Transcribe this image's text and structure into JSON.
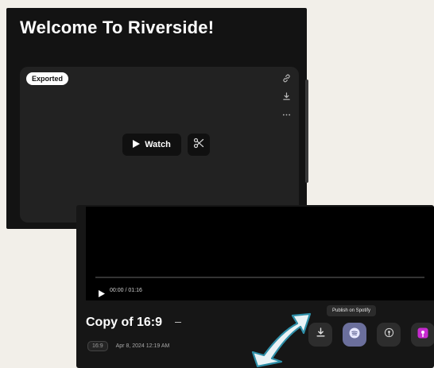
{
  "top_panel": {
    "title": "Welcome To Riverside!",
    "badge": "Exported",
    "watch_label": "Watch"
  },
  "bottom_panel": {
    "time": "00:00 / 01:16",
    "title": "Copy of 16:9",
    "aspect": "16:9",
    "date": "Apr 8, 2024 12:19 AM",
    "tooltip": "Publish on Spotify"
  },
  "icons": [
    "link-icon",
    "download-icon",
    "more-icon",
    "play-icon",
    "scissors-icon",
    "spotify-icon",
    "podcast-icon",
    "arrow-pointer"
  ],
  "colors": {
    "dark_bg": "#131313",
    "card": "#222222",
    "spotify_btn": "#6b6f9c",
    "accent_pink": "#c72ad0",
    "arrow": "#2f8fa8"
  }
}
